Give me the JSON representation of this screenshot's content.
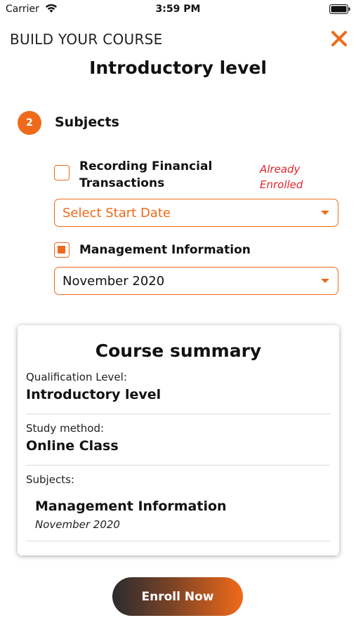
{
  "status_bar": {
    "carrier": "Carrier",
    "time": "3:59 PM"
  },
  "header": {
    "label": "BUILD YOUR COURSE",
    "title": "Introductory level"
  },
  "step": {
    "number": "2",
    "title": "Subjects"
  },
  "subjects": [
    {
      "label_line1": "Recording Financial",
      "label_line2": "Transactions",
      "checked": false,
      "note_line1": "Already",
      "note_line2": "Enrolled",
      "date_value": "Select Start Date"
    },
    {
      "label": "Management Information",
      "checked": true,
      "date_value": "November 2020"
    }
  ],
  "summary": {
    "title": "Course summary",
    "qualification_label": "Qualification Level:",
    "qualification_value": "Introductory level",
    "study_label": "Study method:",
    "study_value": "Online Class",
    "subjects_label": "Subjects:",
    "subject_name": "Management Information",
    "subject_date": "November 2020"
  },
  "enroll_button": "Enroll Now",
  "colors": {
    "accent": "#ee6a1a",
    "alert": "#e0262e"
  }
}
